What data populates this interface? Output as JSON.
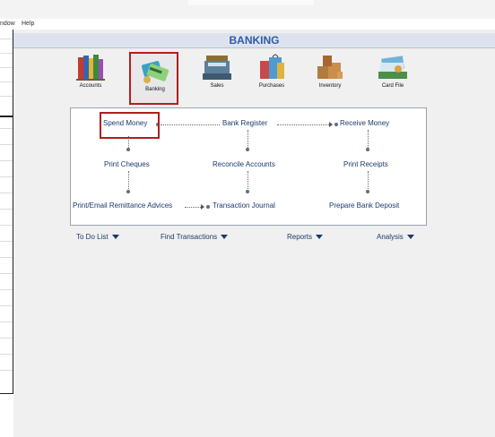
{
  "menubar": {
    "window_partial": "ndow",
    "help": "Help"
  },
  "window_title": "BANKING",
  "modules": [
    {
      "label": "Accounts",
      "icon": "accounts-books-icon"
    },
    {
      "label": "Banking",
      "icon": "banking-cards-icon",
      "selected": true
    },
    {
      "label": "Sales",
      "icon": "sales-register-icon"
    },
    {
      "label": "Purchases",
      "icon": "purchases-bags-icon"
    },
    {
      "label": "Inventory",
      "icon": "inventory-boxes-icon"
    },
    {
      "label": "Card File",
      "icon": "card-file-icon"
    }
  ],
  "tasks": {
    "spend_money": "Spend Money",
    "bank_register": "Bank Register",
    "receive_money": "Receive Money",
    "print_cheques": "Print Cheques",
    "reconcile_accounts": "Reconcile Accounts",
    "print_receipts": "Print Receipts",
    "print_email_remittance": "Print/Email Remittance Advices",
    "transaction_journal": "Transaction Journal",
    "prepare_bank_deposit": "Prepare Bank Deposit"
  },
  "bottom_links": {
    "to_do_list": "To Do List",
    "find_transactions": "Find Transactions",
    "reports": "Reports",
    "analysis": "Analysis"
  },
  "colors": {
    "title": "#2e5aa8",
    "link": "#1b3a6b",
    "highlight": "#b21e1e"
  }
}
